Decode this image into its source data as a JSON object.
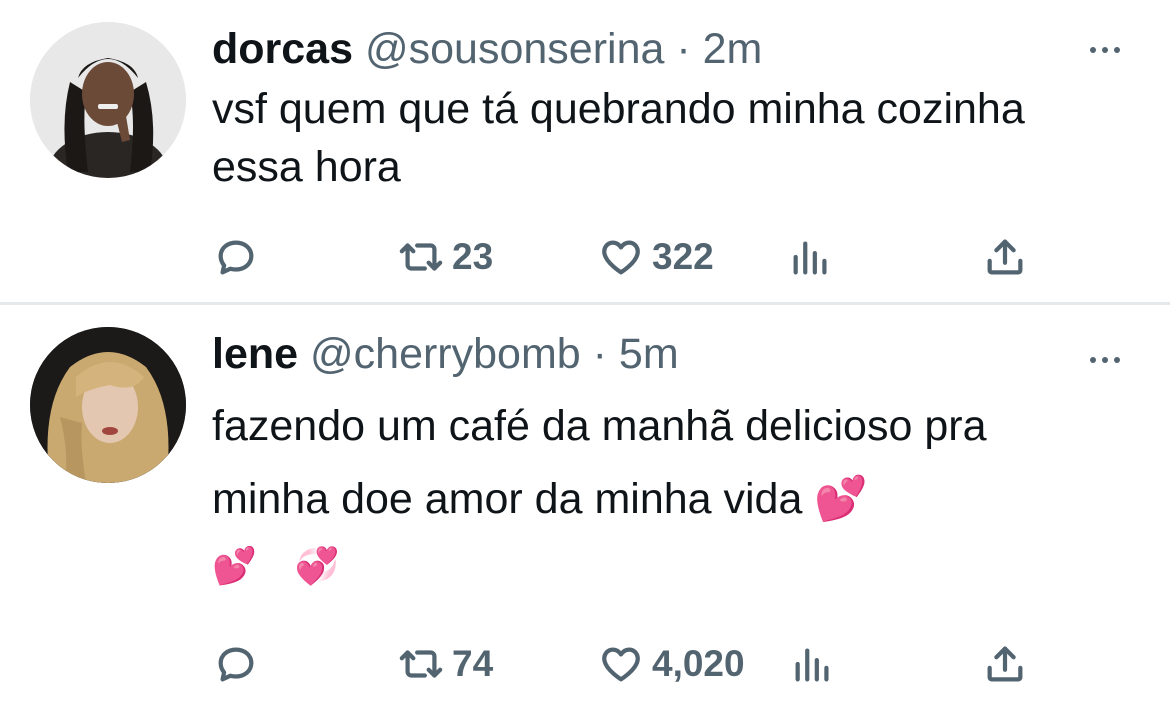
{
  "tweets": [
    {
      "name": "dorcas",
      "handle": "@sousonserina",
      "dot": "·",
      "time": "2m",
      "text": "vsf quem que tá quebrando minha cozinha essa hora",
      "emoji_line": "",
      "retweets": "23",
      "likes": "322",
      "avatar": "avatar-photo"
    },
    {
      "name": "lene",
      "handle": "@cherrybomb",
      "dot": "·",
      "time": "5m",
      "text": "fazendo um café da manhã delicioso pra minha doe amor da minha vida 💕",
      "emoji_line": "💕 💞",
      "retweets": "74",
      "likes": "4,020",
      "avatar": "avatar-photo"
    }
  ],
  "colors": {
    "text": "#0f1419",
    "secondary": "#536471",
    "divider": "#e6e9ec",
    "background": "#ffffff"
  },
  "icons": [
    "reply-icon",
    "retweet-icon",
    "like-icon",
    "views-icon",
    "share-icon",
    "more-icon"
  ]
}
